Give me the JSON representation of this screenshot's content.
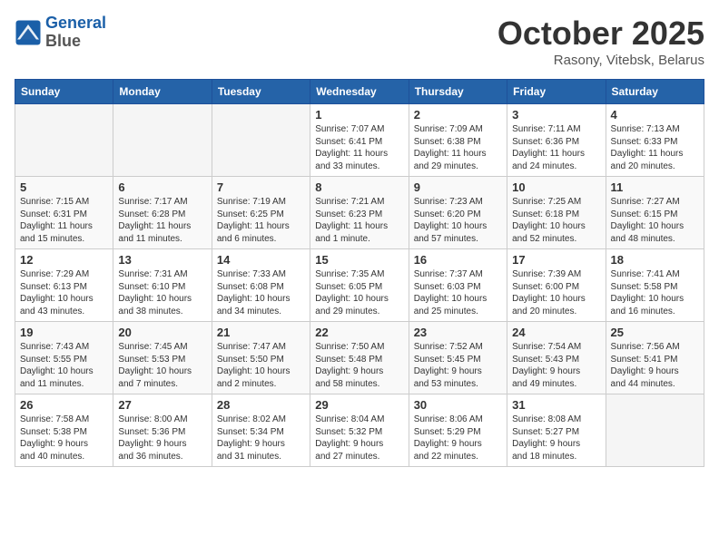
{
  "header": {
    "logo_line1": "General",
    "logo_line2": "Blue",
    "month": "October 2025",
    "location": "Rasony, Vitebsk, Belarus"
  },
  "weekdays": [
    "Sunday",
    "Monday",
    "Tuesday",
    "Wednesday",
    "Thursday",
    "Friday",
    "Saturday"
  ],
  "weeks": [
    [
      {
        "day": "",
        "info": ""
      },
      {
        "day": "",
        "info": ""
      },
      {
        "day": "",
        "info": ""
      },
      {
        "day": "1",
        "info": "Sunrise: 7:07 AM\nSunset: 6:41 PM\nDaylight: 11 hours\nand 33 minutes."
      },
      {
        "day": "2",
        "info": "Sunrise: 7:09 AM\nSunset: 6:38 PM\nDaylight: 11 hours\nand 29 minutes."
      },
      {
        "day": "3",
        "info": "Sunrise: 7:11 AM\nSunset: 6:36 PM\nDaylight: 11 hours\nand 24 minutes."
      },
      {
        "day": "4",
        "info": "Sunrise: 7:13 AM\nSunset: 6:33 PM\nDaylight: 11 hours\nand 20 minutes."
      }
    ],
    [
      {
        "day": "5",
        "info": "Sunrise: 7:15 AM\nSunset: 6:31 PM\nDaylight: 11 hours\nand 15 minutes."
      },
      {
        "day": "6",
        "info": "Sunrise: 7:17 AM\nSunset: 6:28 PM\nDaylight: 11 hours\nand 11 minutes."
      },
      {
        "day": "7",
        "info": "Sunrise: 7:19 AM\nSunset: 6:25 PM\nDaylight: 11 hours\nand 6 minutes."
      },
      {
        "day": "8",
        "info": "Sunrise: 7:21 AM\nSunset: 6:23 PM\nDaylight: 11 hours\nand 1 minute."
      },
      {
        "day": "9",
        "info": "Sunrise: 7:23 AM\nSunset: 6:20 PM\nDaylight: 10 hours\nand 57 minutes."
      },
      {
        "day": "10",
        "info": "Sunrise: 7:25 AM\nSunset: 6:18 PM\nDaylight: 10 hours\nand 52 minutes."
      },
      {
        "day": "11",
        "info": "Sunrise: 7:27 AM\nSunset: 6:15 PM\nDaylight: 10 hours\nand 48 minutes."
      }
    ],
    [
      {
        "day": "12",
        "info": "Sunrise: 7:29 AM\nSunset: 6:13 PM\nDaylight: 10 hours\nand 43 minutes."
      },
      {
        "day": "13",
        "info": "Sunrise: 7:31 AM\nSunset: 6:10 PM\nDaylight: 10 hours\nand 38 minutes."
      },
      {
        "day": "14",
        "info": "Sunrise: 7:33 AM\nSunset: 6:08 PM\nDaylight: 10 hours\nand 34 minutes."
      },
      {
        "day": "15",
        "info": "Sunrise: 7:35 AM\nSunset: 6:05 PM\nDaylight: 10 hours\nand 29 minutes."
      },
      {
        "day": "16",
        "info": "Sunrise: 7:37 AM\nSunset: 6:03 PM\nDaylight: 10 hours\nand 25 minutes."
      },
      {
        "day": "17",
        "info": "Sunrise: 7:39 AM\nSunset: 6:00 PM\nDaylight: 10 hours\nand 20 minutes."
      },
      {
        "day": "18",
        "info": "Sunrise: 7:41 AM\nSunset: 5:58 PM\nDaylight: 10 hours\nand 16 minutes."
      }
    ],
    [
      {
        "day": "19",
        "info": "Sunrise: 7:43 AM\nSunset: 5:55 PM\nDaylight: 10 hours\nand 11 minutes."
      },
      {
        "day": "20",
        "info": "Sunrise: 7:45 AM\nSunset: 5:53 PM\nDaylight: 10 hours\nand 7 minutes."
      },
      {
        "day": "21",
        "info": "Sunrise: 7:47 AM\nSunset: 5:50 PM\nDaylight: 10 hours\nand 2 minutes."
      },
      {
        "day": "22",
        "info": "Sunrise: 7:50 AM\nSunset: 5:48 PM\nDaylight: 9 hours\nand 58 minutes."
      },
      {
        "day": "23",
        "info": "Sunrise: 7:52 AM\nSunset: 5:45 PM\nDaylight: 9 hours\nand 53 minutes."
      },
      {
        "day": "24",
        "info": "Sunrise: 7:54 AM\nSunset: 5:43 PM\nDaylight: 9 hours\nand 49 minutes."
      },
      {
        "day": "25",
        "info": "Sunrise: 7:56 AM\nSunset: 5:41 PM\nDaylight: 9 hours\nand 44 minutes."
      }
    ],
    [
      {
        "day": "26",
        "info": "Sunrise: 7:58 AM\nSunset: 5:38 PM\nDaylight: 9 hours\nand 40 minutes."
      },
      {
        "day": "27",
        "info": "Sunrise: 8:00 AM\nSunset: 5:36 PM\nDaylight: 9 hours\nand 36 minutes."
      },
      {
        "day": "28",
        "info": "Sunrise: 8:02 AM\nSunset: 5:34 PM\nDaylight: 9 hours\nand 31 minutes."
      },
      {
        "day": "29",
        "info": "Sunrise: 8:04 AM\nSunset: 5:32 PM\nDaylight: 9 hours\nand 27 minutes."
      },
      {
        "day": "30",
        "info": "Sunrise: 8:06 AM\nSunset: 5:29 PM\nDaylight: 9 hours\nand 22 minutes."
      },
      {
        "day": "31",
        "info": "Sunrise: 8:08 AM\nSunset: 5:27 PM\nDaylight: 9 hours\nand 18 minutes."
      },
      {
        "day": "",
        "info": ""
      }
    ]
  ]
}
